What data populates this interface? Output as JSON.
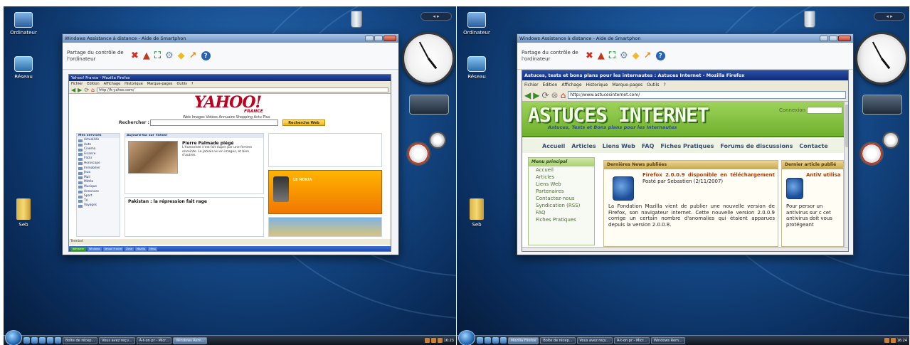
{
  "left": {
    "desktop_icons": [
      {
        "label": "Ordinateur",
        "icon": "computer-icon"
      },
      {
        "label": "Réseau",
        "icon": "network-icon"
      },
      {
        "label": "Seb",
        "icon": "folder-icon"
      }
    ],
    "gadget_bar_label": "◂ ▸",
    "remote_window": {
      "title": "Windows Assistance à distance - Aide de Smartphon",
      "share_label": "Partage du contrôle de l'ordinateur",
      "toolbar_icons": [
        "✖",
        "▲",
        "⛶",
        "⚙",
        "◆",
        "↗",
        "?"
      ]
    },
    "inner_browser": {
      "title": "Yahoo! France - Mozilla Firefox",
      "menu": [
        "Fichier",
        "Edition",
        "Affichage",
        "Historique",
        "Marque-pages",
        "Outils",
        "?"
      ],
      "url": "http://fr.yahoo.com/",
      "logo": "YAHOO!",
      "logo_sub": "FRANCE",
      "tabs": "Web  Images  Vidéos  Annuaire  Shopping  Actu  Plus",
      "search_label": "Rechercher :",
      "search_button": "Recherche Web",
      "sidebar_header": "Mes services",
      "sidebar_items": [
        "Actualités",
        "Auto",
        "Cinéma",
        "Finance",
        "Flickr",
        "Horoscope",
        "Immobilier",
        "Jeux",
        "Mail",
        "Météo",
        "Musique",
        "Annonces",
        "Sport",
        "TV",
        "Voyages"
      ],
      "feature_header": "Aujourd'hui sur Yahoo!",
      "feature_title": "Pierre Palmade piégé",
      "feature_text": "L'humoriste s'est fait duper par une femme enceinte. Le jamais-vu en images, et bien d'autres.",
      "news_title": "Pakistan : la répression fait rage",
      "ad_text": "LE NOKIA",
      "status": "Terminé"
    },
    "inner_taskbar_start": "démarrer",
    "inner_taskbar_items": [
      "Windows",
      "Yahoo! France",
      "Zone",
      "Mozilla",
      "Mess"
    ],
    "taskbar_items": [
      "Boîte de récep...",
      "Vous avez reçu...",
      "À-t-on pr - Micr...",
      "Windows Rem..."
    ],
    "tray_time": "16:23"
  },
  "right": {
    "desktop_icons": [
      {
        "label": "Ordinateur",
        "icon": "computer-icon"
      },
      {
        "label": "Réseau",
        "icon": "network-icon"
      },
      {
        "label": "Seb",
        "icon": "folder-icon"
      }
    ],
    "gadget_bar_label": "◂ ▸",
    "remote_window": {
      "title": "Windows Assistance à distance - Aide de Smartphon",
      "share_label": "Partage du contrôle de l'ordinateur",
      "toolbar_icons": [
        "✖",
        "▲",
        "⛶",
        "⚙",
        "◆",
        "↗",
        "?"
      ]
    },
    "inner_browser": {
      "title": "Astuces, tests et bons plans pour les internautes : Astuces Internet - Mozilla Firefox",
      "menu": [
        "Fichier",
        "Édition",
        "Affichage",
        "Historique",
        "Marque-pages",
        "Outils",
        "?"
      ],
      "url": "http://www.astucesinternet.com/",
      "logo": "ASTUCES INTERNET",
      "tagline": "Astuces, Tests et Bons plans pour les Internautes",
      "connexion": "Connexion",
      "nav": [
        "Accueil",
        "Articles",
        "Liens Web",
        "FAQ",
        "Fiches Pratiques",
        "Forums de discussions",
        "Contacte"
      ],
      "side_header": "Menu principal",
      "side_items": [
        "Accueil",
        "Articles",
        "Liens Web",
        "Partenaires",
        "Contactez-nous",
        "Syndication (RSS)",
        "FAQ",
        "Fiches Pratiques"
      ],
      "news_header": "Dernières News publiées",
      "news_headline": "Firefox 2.0.0.9 disponible en téléchargement",
      "news_byline": "Posté par Sebastien (2/11/2007)",
      "news_body": "La Fondation Mozilla vient de publier une nouvelle version de Firefox, son navigateur internet. Cette nouvelle version 2.0.0.9 corrige un certain nombre d'anomalies qui étaient apparues depuis la version 2.0.0.8.",
      "article_header": "Dernier article publié",
      "article_headline": "AntiV utilisa",
      "article_body": "Pour persor un antivirus sur c cet antivirus doit vous protégeant"
    },
    "taskbar_items": [
      "Mozilla Firefox",
      "Boîte de récep...",
      "Vous avez reçu...",
      "À-t-on pr - Micr...",
      "Windows Rem..."
    ],
    "tray_time": "16:24"
  },
  "colors": {
    "desktop": "#164c8c",
    "yahoo_red": "#c0001f",
    "astuces_green": "#6fb02e",
    "firefox_title": "#0d2a7a"
  }
}
